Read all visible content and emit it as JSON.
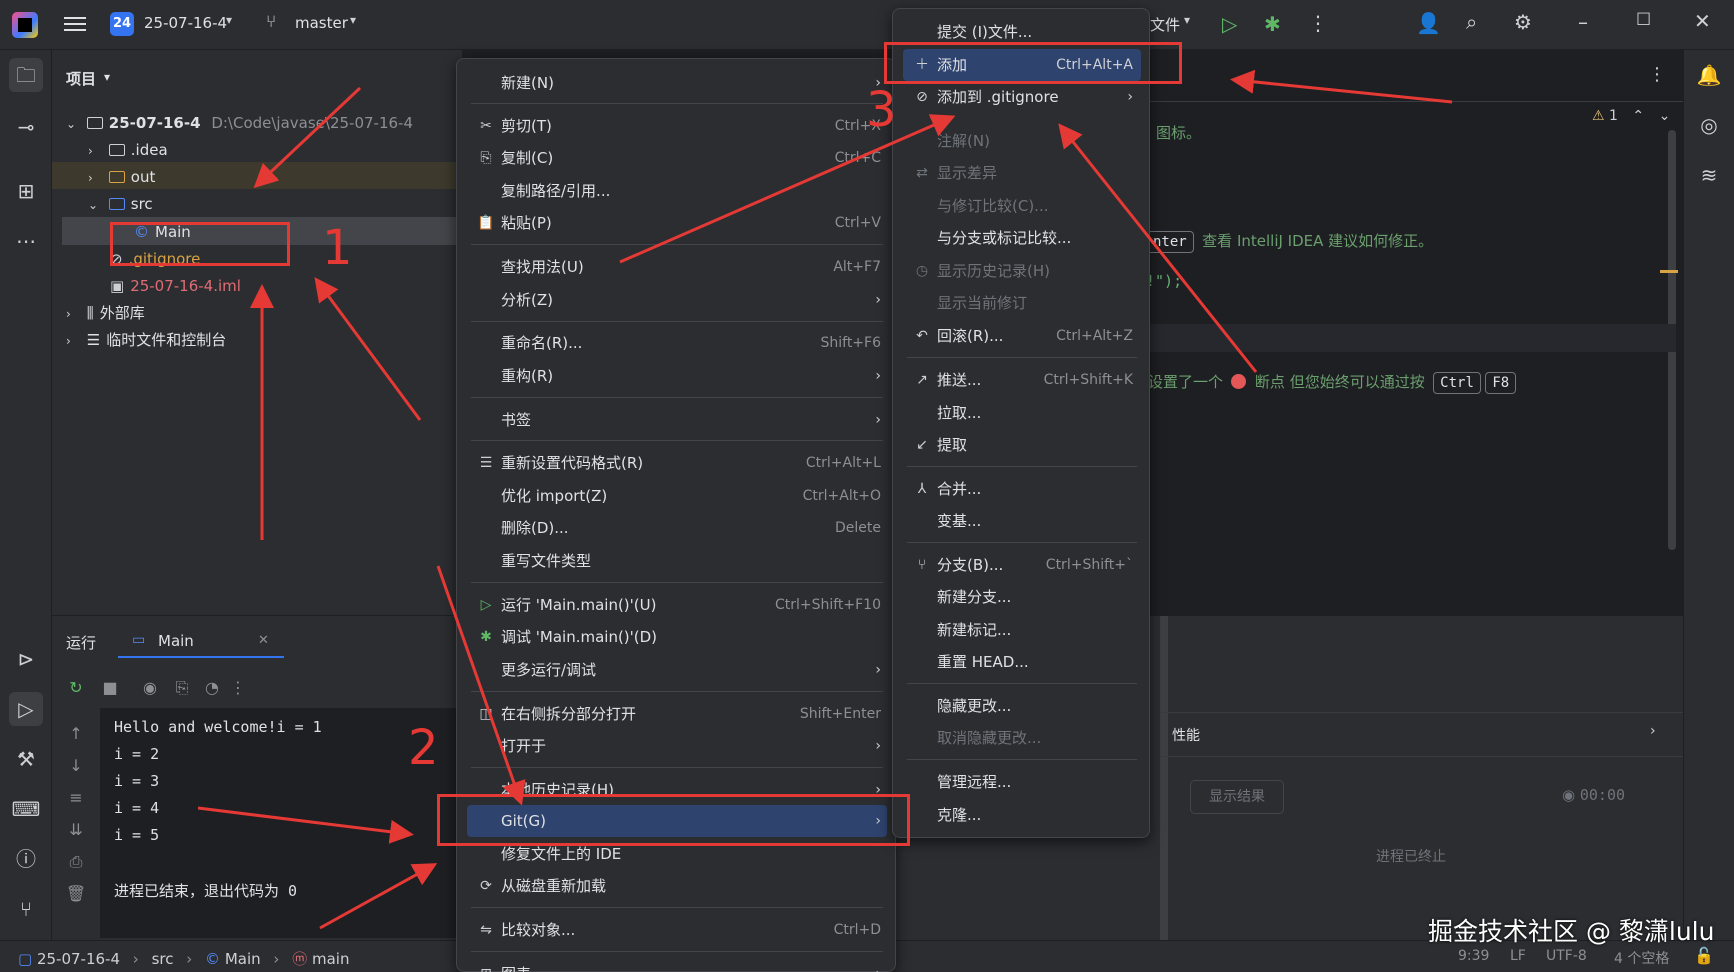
{
  "titlebar": {
    "project_badge": "24",
    "project_name": "25-07-16-4",
    "branch": "master",
    "file_menu": "文件",
    "icons": [
      "hamburger-icon",
      "branch-icon",
      "run-icon",
      "debug-icon",
      "more-icon",
      "add-user-icon",
      "search-icon",
      "settings-icon",
      "minimize-icon",
      "maximize-icon",
      "close-icon"
    ]
  },
  "project_panel": {
    "title": "项目",
    "tree": [
      {
        "label": "25-07-16-4",
        "path": "D:\\Code\\javase\\25-07-16-4"
      },
      {
        "label": ".idea"
      },
      {
        "label": "out"
      },
      {
        "label": "src"
      },
      {
        "label": "Main"
      },
      {
        "label": ".gitignore"
      },
      {
        "label": "25-07-16-4.iml"
      },
      {
        "label": "外部库"
      },
      {
        "label": "临时文件和控制台"
      }
    ]
  },
  "editor": {
    "warning_count": "1",
    "hint_icon_text": "图标。",
    "hint_enter_key": "nter",
    "hint_enter_text": "查看 IntelliJ IDEA 建议如何修正。",
    "code_fragment": "!\");",
    "hint_break_prefix": "设置了一个",
    "hint_break_text": "断点 但您始终可以通过按",
    "key_ctrl": "Ctrl",
    "key_f8": "F8"
  },
  "run_panel": {
    "tab_run": "运行",
    "tab_main": "Main",
    "console": [
      "Hello and welcome!i = 1",
      "i = 2",
      "i = 3",
      "i = 4",
      "i = 5",
      "",
      "进程已结束，退出代码为 0"
    ],
    "perf_title": "性能",
    "show_result": "显示结果",
    "timer": "00:00",
    "process_ended": "进程已终止"
  },
  "context_menu": {
    "items": [
      {
        "label": "新建(N)",
        "submenu": true
      },
      {
        "label": "剪切(T)",
        "shortcut": "Ctrl+X"
      },
      {
        "label": "复制(C)",
        "shortcut": "Ctrl+C"
      },
      {
        "label": "复制路径/引用..."
      },
      {
        "label": "粘贴(P)",
        "shortcut": "Ctrl+V"
      },
      {
        "label": "查找用法(U)",
        "shortcut": "Alt+F7"
      },
      {
        "label": "分析(Z)",
        "submenu": true
      },
      {
        "label": "重命名(R)...",
        "shortcut": "Shift+F6"
      },
      {
        "label": "重构(R)",
        "submenu": true
      },
      {
        "label": "书签",
        "submenu": true
      },
      {
        "label": "重新设置代码格式(R)",
        "shortcut": "Ctrl+Alt+L"
      },
      {
        "label": "优化 import(Z)",
        "shortcut": "Ctrl+Alt+O"
      },
      {
        "label": "删除(D)...",
        "shortcut": "Delete"
      },
      {
        "label": "重写文件类型"
      },
      {
        "label": "运行 'Main.main()'(U)",
        "shortcut": "Ctrl+Shift+F10"
      },
      {
        "label": "调试 'Main.main()'(D)"
      },
      {
        "label": "更多运行/调试",
        "submenu": true
      },
      {
        "label": "在右侧拆分部分打开",
        "shortcut": "Shift+Enter"
      },
      {
        "label": "打开于",
        "submenu": true
      },
      {
        "label": "本地历史记录(H)",
        "submenu": true
      },
      {
        "label": "Git(G)",
        "submenu": true
      },
      {
        "label": "修复文件上的 IDE"
      },
      {
        "label": "从磁盘重新加载"
      },
      {
        "label": "比较对象...",
        "shortcut": "Ctrl+D"
      },
      {
        "label": "图表",
        "submenu": true
      }
    ]
  },
  "git_submenu": {
    "items": [
      {
        "label": "提交 (I)文件..."
      },
      {
        "label": "添加",
        "shortcut": "Ctrl+Alt+A"
      },
      {
        "label": "添加到 .gitignore",
        "submenu": true
      },
      {
        "label": "注解(N)",
        "disabled": true
      },
      {
        "label": "显示差异",
        "disabled": true
      },
      {
        "label": "与修订比较(C)...",
        "disabled": true
      },
      {
        "label": "与分支或标记比较..."
      },
      {
        "label": "显示历史记录(H)",
        "disabled": true
      },
      {
        "label": "显示当前修订",
        "disabled": true
      },
      {
        "label": "回滚(R)...",
        "shortcut": "Ctrl+Alt+Z"
      },
      {
        "label": "推送...",
        "shortcut": "Ctrl+Shift+K"
      },
      {
        "label": "拉取..."
      },
      {
        "label": "提取"
      },
      {
        "label": "合并..."
      },
      {
        "label": "变基..."
      },
      {
        "label": "分支(B)...",
        "shortcut": "Ctrl+Shift+`"
      },
      {
        "label": "新建分支..."
      },
      {
        "label": "新建标记..."
      },
      {
        "label": "重置 HEAD..."
      },
      {
        "label": "隐藏更改..."
      },
      {
        "label": "取消隐藏更改...",
        "disabled": true
      },
      {
        "label": "管理远程..."
      },
      {
        "label": "克隆..."
      }
    ]
  },
  "statusbar": {
    "breadcrumb": [
      "25-07-16-4",
      "src",
      "Main",
      "main"
    ],
    "position": "9:39",
    "line_sep": "LF",
    "encoding": "UTF-8",
    "indent": "4 个空格"
  },
  "annotations": {
    "num1": "1",
    "num2": "2",
    "num3": "3",
    "color": "#e53935"
  },
  "watermark": "掘金技术社区 @ 黎潇lulu"
}
